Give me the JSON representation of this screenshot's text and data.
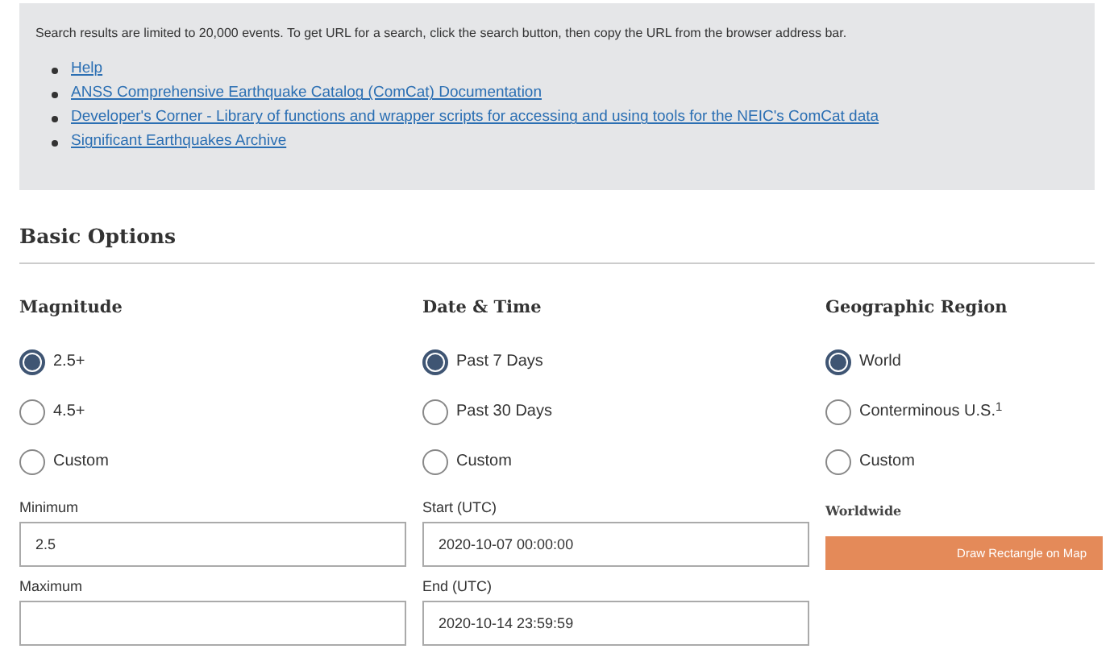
{
  "notice": {
    "text": "Search results are limited to 20,000 events. To get URL for a search, click the search button, then copy the URL from the browser address bar.",
    "links": [
      "Help",
      "ANSS Comprehensive Earthquake Catalog (ComCat) Documentation",
      "Developer's Corner - Library of functions and wrapper scripts for accessing and using tools for the NEIC's ComCat data",
      "Significant Earthquakes Archive"
    ]
  },
  "section_title": "Basic Options",
  "columns": [
    {
      "title": "Magnitude",
      "options": [
        {
          "label": "2.5+",
          "selected": true
        },
        {
          "label": "4.5+",
          "selected": false
        },
        {
          "label": "Custom",
          "selected": false
        }
      ],
      "fields": [
        {
          "label": "Minimum",
          "value": "2.5"
        },
        {
          "label": "Maximum"
        }
      ]
    },
    {
      "title": "Date & Time",
      "options": [
        {
          "label": "Past 7 Days",
          "selected": true
        },
        {
          "label": "Past 30 Days",
          "selected": false
        },
        {
          "label": "Custom",
          "selected": false
        }
      ],
      "fields": [
        {
          "label": "Start (UTC)",
          "value": "2020-10-07 00:00:00"
        },
        {
          "label": "End (UTC)",
          "value": "2020-10-14 23:59:59"
        }
      ]
    },
    {
      "title": "Geographic Region",
      "options": [
        {
          "label": "World",
          "selected": true
        },
        {
          "label": "Conterminous U.S.$^{1}$",
          "selected": false
        },
        {
          "label": "Custom",
          "selected": false
        }
      ],
      "region_label": "Worldwide",
      "button": "Draw Rectangle on Map"
    }
  ]
}
